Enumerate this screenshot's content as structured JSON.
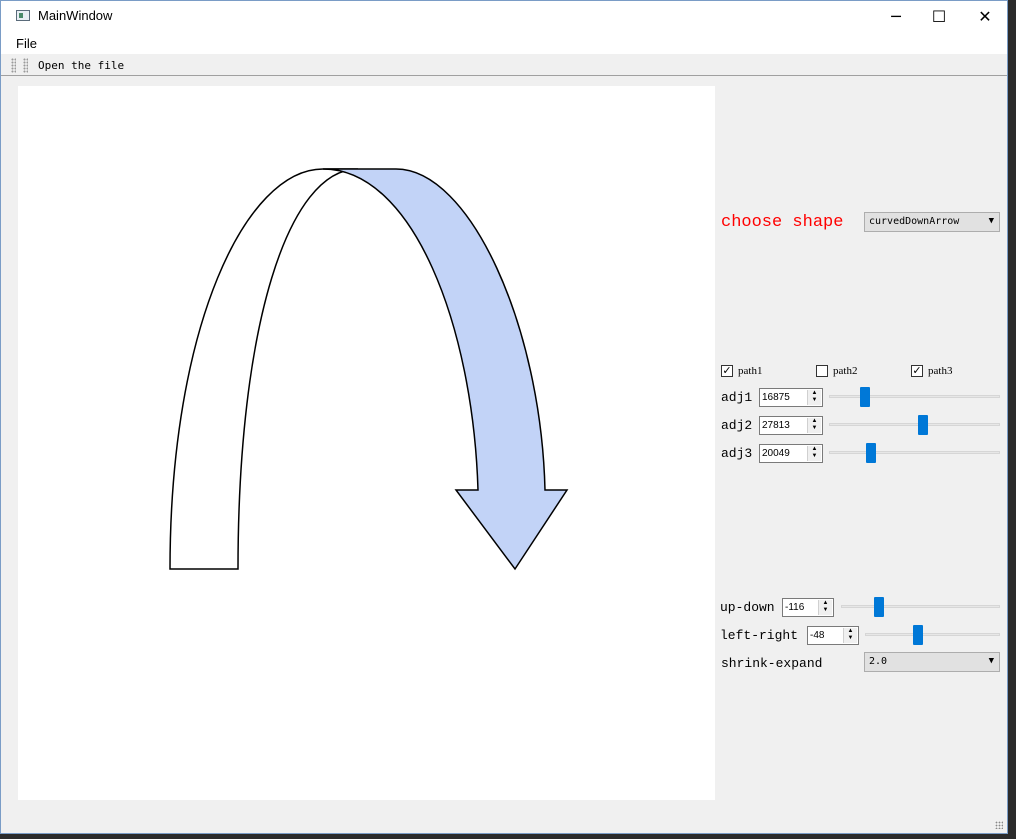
{
  "window": {
    "title": "MainWindow",
    "minimize": "─",
    "maximize": "☐",
    "close": "✕"
  },
  "menu": {
    "file": "File"
  },
  "toolbar": {
    "open_file": "Open the file"
  },
  "shape": {
    "label": "choose shape",
    "selected": "curvedDownArrow"
  },
  "paths": [
    {
      "label": "path1",
      "checked": true
    },
    {
      "label": "path2",
      "checked": false
    },
    {
      "label": "path3",
      "checked": true
    }
  ],
  "adjust": [
    {
      "label": "adj1",
      "value": "16875",
      "slider_fraction": 0.19
    },
    {
      "label": "adj2",
      "value": "27813",
      "slider_fraction": 0.55
    },
    {
      "label": "adj3",
      "value": "20049",
      "slider_fraction": 0.23
    }
  ],
  "position": {
    "up_down": {
      "label": "up-down",
      "value": "-116",
      "slider_fraction": 0.22
    },
    "left_right": {
      "label": "left-right",
      "value": "-48",
      "slider_fraction": 0.38
    }
  },
  "scale": {
    "label": "shrink-expand",
    "selected": "2.0"
  },
  "colors": {
    "arrow_fill": "#c2d3f7",
    "choose_label": "#ff0000",
    "slider_handle": "#0078d7"
  },
  "icons": {
    "checkbox_check": "✓",
    "combo_arrow": "▼",
    "spin_up": "▲",
    "spin_down": "▼"
  }
}
